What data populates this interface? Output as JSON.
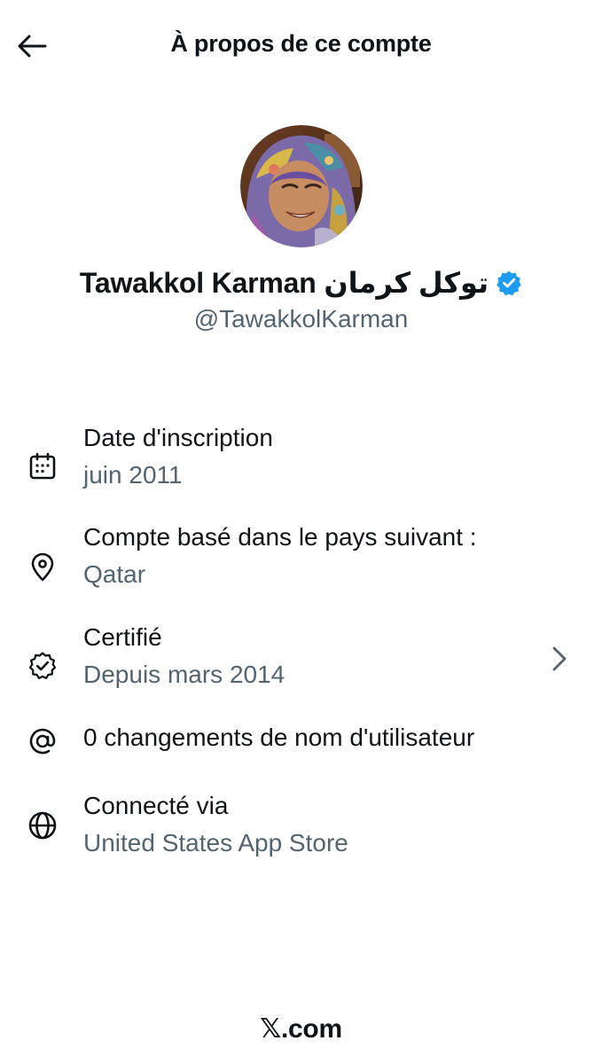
{
  "header": {
    "title": "À propos de ce compte"
  },
  "profile": {
    "display_name": "Tawakkol Karman توكل كرمان",
    "handle": "@TawakkolKarman",
    "verified_color": "#1d9bf0"
  },
  "info": {
    "joined": {
      "label": "Date d'inscription",
      "value": "juin 2011",
      "icon": "calendar-icon"
    },
    "country": {
      "label": "Compte basé dans le pays suivant :",
      "value": "Qatar",
      "icon": "location-pin-icon"
    },
    "verified": {
      "label": "Certifié",
      "value": "Depuis mars 2014",
      "icon": "verified-badge-icon"
    },
    "username_changes": {
      "label": "0 changements de nom d'utilisateur",
      "icon": "at-icon"
    },
    "connected": {
      "label": "Connecté via",
      "value": "United States App Store",
      "icon": "globe-icon"
    }
  },
  "footer": {
    "x_mark": "𝕏",
    "domain": ".com"
  }
}
